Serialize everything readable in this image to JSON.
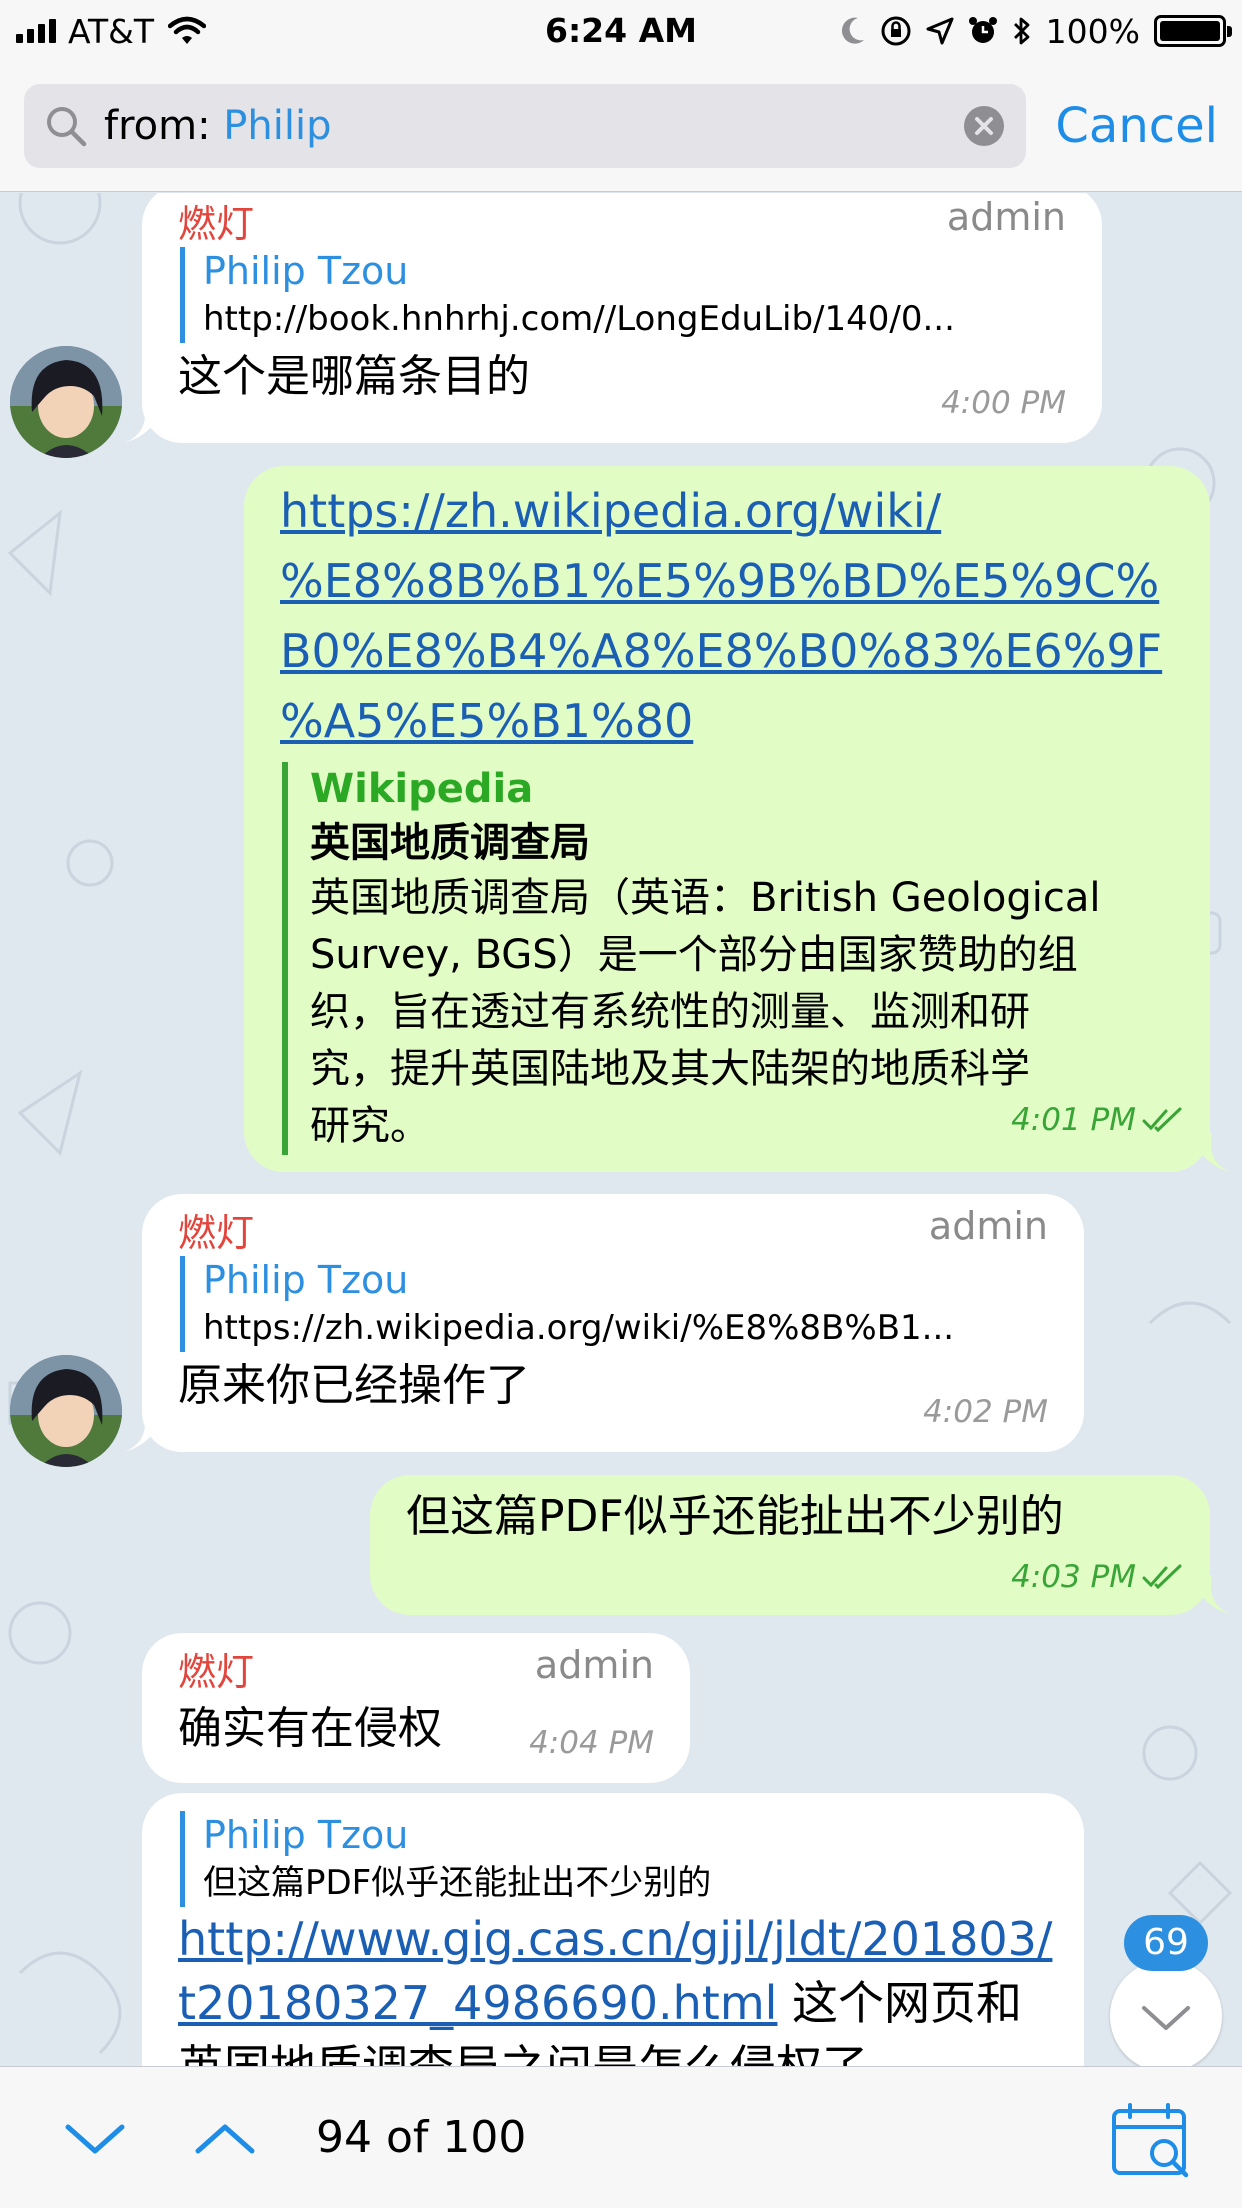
{
  "status_bar": {
    "carrier": "AT&T",
    "time": "6:24 AM",
    "battery": "100%"
  },
  "search": {
    "prefix": "from: ",
    "query": "Philip",
    "cancel_label": "Cancel"
  },
  "messages": [
    {
      "sender": "燃灯",
      "role": "admin",
      "reply_name": "Philip Tzou",
      "reply_text": "http://book.hnhrhj.com//LongEduLib/140/0...",
      "text": "这个是哪篇条目的",
      "time": "4:00 PM"
    },
    {
      "link_lines": [
        "https://zh.wikipedia.org/wiki/",
        "%E8%8B%B1%E5%9B%BD%E5%9C%",
        "B0%E8%B4%A8%E8%B0%83%E6%9F",
        "%A5%E5%B1%80"
      ],
      "preview_site": "Wikipedia",
      "preview_title": "英国地质调查局",
      "preview_desc_lines": [
        "英国地质调查局（英语：British Geological",
        "Survey, BGS）是一个部分由国家赞助的组",
        "织，旨在透过有系统性的测量、监测和研",
        "究，提升英国陆地及其大陆架的地质科学",
        "研究。"
      ],
      "time": "4:01 PM"
    },
    {
      "sender": "燃灯",
      "role": "admin",
      "reply_name": "Philip Tzou",
      "reply_text": "https://zh.wikipedia.org/wiki/%E8%8B%B1...",
      "text": "原来你已经操作了",
      "time": "4:02 PM"
    },
    {
      "text": "但这篇PDF似乎还能扯出不少别的",
      "time": "4:03 PM"
    },
    {
      "sender": "燃灯",
      "role": "admin",
      "text": "确实有在侵权",
      "time": "4:04 PM"
    },
    {
      "reply_name": "Philip Tzou",
      "reply_text": "但这篇PDF似乎还能扯出不少别的",
      "link_lines": [
        "http://www.gig.cas.cn/gjjl/jldt/201803/",
        "t20180327_4986690.html"
      ],
      "text_after_link": " 这个网页和",
      "text_line2": "英国地质调查局之间是怎么侵权了"
    }
  ],
  "unread_badge": "69",
  "toolbar": {
    "counter": "94 of 100"
  },
  "colors": {
    "accent": "#1e8de8",
    "sender": "#e2453c",
    "outgoing_bubble": "#e2fcc6",
    "chat_background": "#dfe7ef"
  }
}
